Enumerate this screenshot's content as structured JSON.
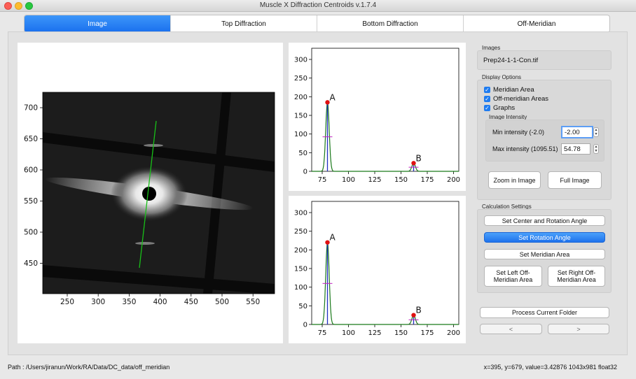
{
  "window": {
    "title": "Muscle X Diffraction Centroids v.1.7.4"
  },
  "tabs": [
    {
      "label": "Image",
      "active": true
    },
    {
      "label": "Top Diffraction",
      "active": false
    },
    {
      "label": "Bottom Diffraction",
      "active": false
    },
    {
      "label": "Off-Meridian",
      "active": false
    }
  ],
  "image_panel": {
    "x_ticks": [
      "250",
      "300",
      "350",
      "400",
      "450",
      "500",
      "550"
    ],
    "y_ticks": [
      "700",
      "650",
      "600",
      "550",
      "500",
      "450"
    ]
  },
  "chart_data": [
    {
      "type": "line",
      "name": "top-diffraction-plot",
      "x_ticks": [
        75,
        100,
        125,
        150,
        175,
        200
      ],
      "y_ticks": [
        0,
        50,
        100,
        150,
        200,
        250,
        300
      ],
      "xlim": [
        65,
        205
      ],
      "ylim": [
        0,
        330
      ],
      "peaks": [
        {
          "label": "A",
          "x": 80,
          "y": 185,
          "width": 3
        },
        {
          "label": "B",
          "x": 162,
          "y": 22,
          "width": 3
        }
      ]
    },
    {
      "type": "line",
      "name": "bottom-diffraction-plot",
      "x_ticks": [
        75,
        100,
        125,
        150,
        175,
        200
      ],
      "y_ticks": [
        0,
        50,
        100,
        150,
        200,
        250,
        300
      ],
      "xlim": [
        65,
        205
      ],
      "ylim": [
        0,
        330
      ],
      "peaks": [
        {
          "label": "A",
          "x": 80,
          "y": 220,
          "width": 3
        },
        {
          "label": "B",
          "x": 162,
          "y": 25,
          "width": 3
        }
      ]
    }
  ],
  "sidebar": {
    "images_label": "Images",
    "image_file": "Prep24-1-1-Con.tif",
    "display_label": "Display Options",
    "cb_meridian": "Meridian Area",
    "cb_offmeridian": "Off-meridian Areas",
    "cb_graphs": "Graphs",
    "intensity_label": "Image Intensity",
    "min_label": "Min intensity (-2.0)",
    "min_value": "-2.00",
    "max_label": "Max intensity (1095.51)",
    "max_value": "54.78",
    "zoom_btn": "Zoom in Image",
    "full_btn": "Full Image",
    "calc_label": "Calculation Settings",
    "set_center_btn": "Set Center and Rotation Angle",
    "set_rotation_btn": "Set Rotation Angle",
    "set_meridian_btn": "Set Meridian Area",
    "set_left_btn": "Set Left Off-Meridian Area",
    "set_right_btn": "Set Right Off-Meridian Area",
    "process_btn": "Process Current Folder",
    "prev_btn": "<",
    "next_btn": ">"
  },
  "status": {
    "path": "Path : /Users/jiranun/Work/RA/Data/DC_data/off_meridian",
    "info": "x=395, y=679, value=3.42876  1043x981 float32"
  },
  "colors": {
    "accent": "#1f7cf0",
    "curve": "#1b7a1b",
    "marker": "#e01010",
    "centroid": "#2030c0",
    "cross": "#c020c0"
  }
}
